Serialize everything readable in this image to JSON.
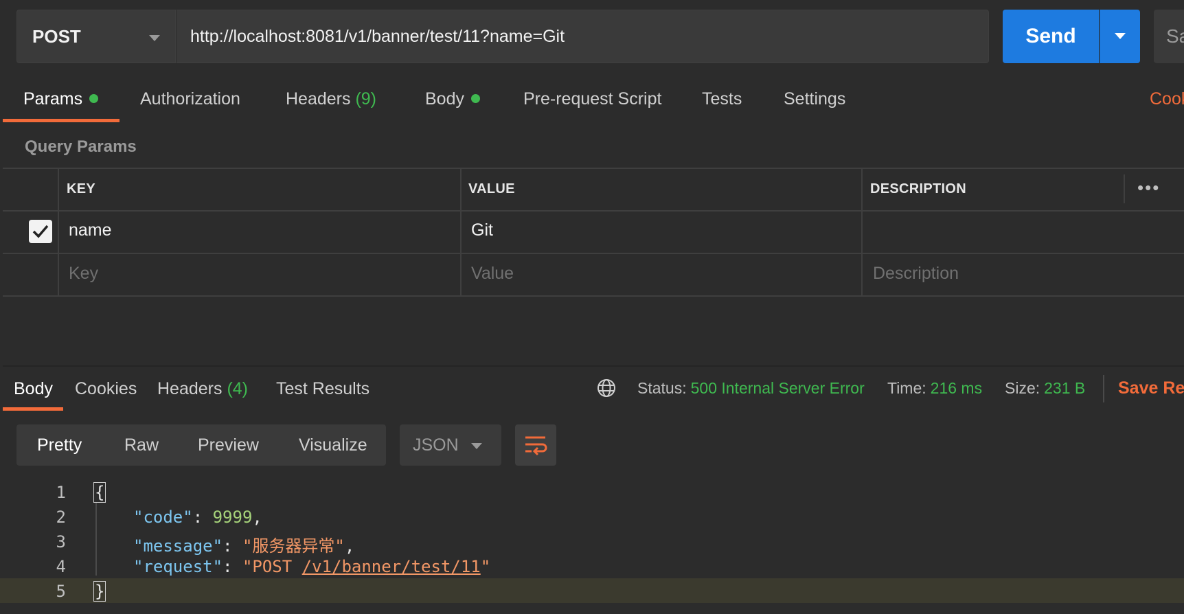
{
  "request": {
    "method": "POST",
    "url": "http://localhost:8081/v1/banner/test/11?name=Git",
    "send_label": "Send",
    "save_label": "Sa"
  },
  "request_tabs": {
    "params": "Params",
    "authorization": "Authorization",
    "headers": "Headers",
    "headers_count": "(9)",
    "body": "Body",
    "prerequest": "Pre-request Script",
    "tests": "Tests",
    "settings": "Settings",
    "cookies": "Cook"
  },
  "query_params": {
    "title": "Query Params",
    "columns": {
      "key": "KEY",
      "value": "VALUE",
      "description": "DESCRIPTION"
    },
    "rows": [
      {
        "checked": true,
        "key": "name",
        "value": "Git",
        "description": ""
      }
    ],
    "placeholders": {
      "key": "Key",
      "value": "Value",
      "description": "Description"
    },
    "more_label": "•••"
  },
  "response_tabs": {
    "body": "Body",
    "cookies": "Cookies",
    "headers": "Headers",
    "headers_count": "(4)",
    "test_results": "Test Results"
  },
  "response_status": {
    "status_label": "Status:",
    "status_value": "500 Internal Server Error",
    "time_label": "Time:",
    "time_value": "216 ms",
    "size_label": "Size:",
    "size_value": "231 B",
    "save_response": "Save Res"
  },
  "view": {
    "modes": [
      "Pretty",
      "Raw",
      "Preview",
      "Visualize"
    ],
    "format": "JSON"
  },
  "code": {
    "line_numbers": [
      "1",
      "2",
      "3",
      "4",
      "5"
    ],
    "open_brace": "{",
    "close_brace": "}",
    "code_key": "\"code\"",
    "code_value": "9999",
    "message_key": "\"message\"",
    "message_value": "\"服务器异常\"",
    "request_key": "\"request\"",
    "request_value_prefix": "\"POST ",
    "request_value_path": "/v1/banner/test/11",
    "request_value_suffix": "\""
  },
  "colors": {
    "accent_orange": "#f26b3a",
    "send_blue": "#1e7be0",
    "status_green": "#3fb950",
    "background": "#2c2c2c"
  }
}
